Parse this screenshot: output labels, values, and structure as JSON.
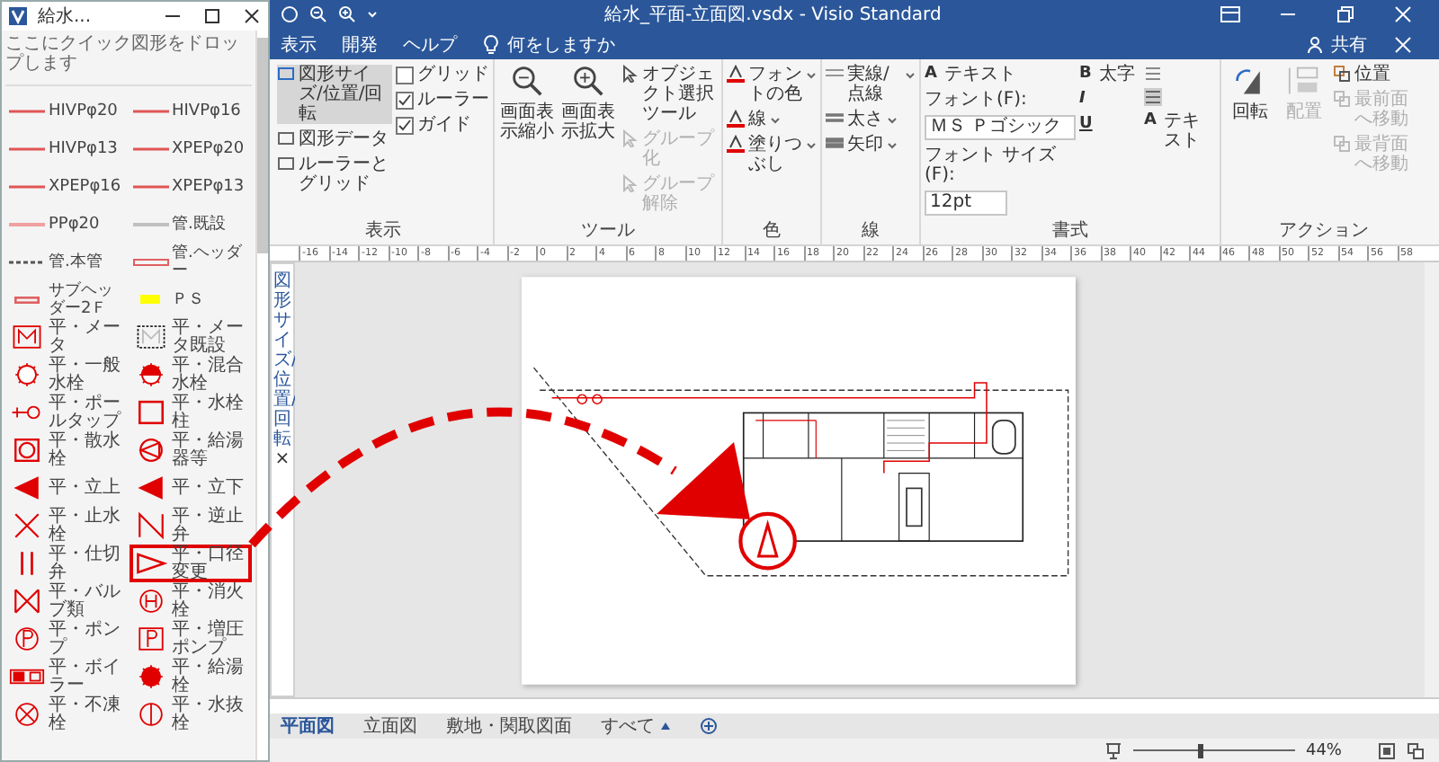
{
  "title_bar": {
    "title": "給水_平面-立面図.vsdx  -  Visio Standard"
  },
  "menu": {
    "tabs": [
      "表示",
      "開発",
      "ヘルプ"
    ],
    "tell_me": "何をしますか",
    "share": "共有"
  },
  "ribbon": {
    "view": {
      "label": "表示",
      "buttons": [
        {
          "label": "図形サイズ/位置/回転",
          "selected": true
        },
        {
          "label": "図形データ",
          "selected": false
        },
        {
          "label": "ルーラーとグリッド",
          "selected": false
        }
      ],
      "checks": [
        {
          "label": "グリッド",
          "checked": false
        },
        {
          "label": "ルーラー",
          "checked": true
        },
        {
          "label": "ガイド",
          "checked": true
        }
      ]
    },
    "tools": {
      "label": "ツール",
      "zoom": [
        {
          "label": "画面表示縮小",
          "kind": "zoom-out"
        },
        {
          "label": "画面表示拡大",
          "kind": "zoom-in"
        }
      ],
      "items": [
        {
          "label": "オブジェクト選択ツール",
          "disabled": false
        },
        {
          "label": "グループ化",
          "disabled": true
        },
        {
          "label": "グループ解除",
          "disabled": true
        }
      ]
    },
    "color": {
      "label": "色",
      "items": [
        "フォントの色",
        "線",
        "塗りつぶし"
      ]
    },
    "line": {
      "label": "線",
      "items": [
        "実線/点線",
        "太さ",
        "矢印"
      ]
    },
    "format": {
      "label": "書式",
      "text_button": {
        "glyph": "A",
        "label": "テキスト"
      },
      "font_label": "フォント(F):",
      "font": "ＭＳ Ｐゴシック",
      "size_label": "フォント サイズ(F):",
      "size": "12pt",
      "bold_glyph": "B",
      "bold": "太字",
      "italic": "I",
      "underline": "U",
      "text_button_2": {
        "glyph": "A",
        "label": "テキスト"
      }
    },
    "actions": {
      "label": "アクション",
      "rotate": "回転",
      "arrange": {
        "label": "配置",
        "disabled": true
      },
      "items": [
        {
          "label": "位置",
          "disabled": false
        },
        {
          "label": "最前面へ移動",
          "disabled": true
        },
        {
          "label": "最背面へ移動",
          "disabled": true
        }
      ]
    }
  },
  "stencil": {
    "title": "給水...",
    "hint": "ここにクイック図形をドロップします",
    "items": [
      {
        "label": "HIVPφ20",
        "kind": "line",
        "color": "#e05555",
        "selected": false
      },
      {
        "label": "HIVPφ16",
        "kind": "line",
        "color": "#e05555",
        "selected": false
      },
      {
        "label": "HIVPφ13",
        "kind": "line",
        "color": "#e05555",
        "selected": false
      },
      {
        "label": "XPEPφ20",
        "kind": "line",
        "color": "#e05555",
        "selected": false
      },
      {
        "label": "XPEPφ16",
        "kind": "line",
        "color": "#e05555",
        "selected": false
      },
      {
        "label": "XPEPφ13",
        "kind": "line",
        "color": "#e05555",
        "selected": false
      },
      {
        "label": "PPφ20",
        "kind": "thick-line",
        "color": "#f0a0a0",
        "selected": false
      },
      {
        "label": "管.既設",
        "kind": "thick-line",
        "color": "#c0c0c0",
        "selected": false
      },
      {
        "label": "管.本管",
        "kind": "dashed",
        "color": "#555555",
        "selected": false
      },
      {
        "label": "管.ヘッダー",
        "kind": "double",
        "color": "#e06060",
        "selected": false
      },
      {
        "label": "サブヘッダー2Ｆ",
        "kind": "block",
        "color": "#e06060",
        "selected": false
      },
      {
        "label": "ＰＳ",
        "kind": "fill-block",
        "color": "#ffff00",
        "selected": false
      },
      {
        "label": "平・メータ",
        "kind": "meter",
        "selected": false
      },
      {
        "label": "平・メータ既設",
        "kind": "meter-dashed",
        "selected": false
      },
      {
        "label": "平・一般水栓",
        "kind": "spiked-circle",
        "selected": false
      },
      {
        "label": "平・混合水栓",
        "kind": "half-spiked",
        "selected": false
      },
      {
        "label": "平・ポールタップ",
        "kind": "pole-tap",
        "selected": false
      },
      {
        "label": "平・水栓柱",
        "kind": "square",
        "selected": false
      },
      {
        "label": "平・散水栓",
        "kind": "boxed-circle",
        "selected": false
      },
      {
        "label": "平・給湯器等",
        "kind": "circle-triangle",
        "selected": false
      },
      {
        "label": "平・立上",
        "kind": "filled-triangle",
        "selected": false
      },
      {
        "label": "平・立下",
        "kind": "filled-triangle",
        "selected": false
      },
      {
        "label": "平・止水栓",
        "kind": "cross",
        "selected": false
      },
      {
        "label": "平・逆止弁",
        "kind": "check",
        "selected": false
      },
      {
        "label": "平・仕切弁",
        "kind": "double-bar",
        "selected": false
      },
      {
        "label": "平・口径変更",
        "kind": "open-triangle",
        "selected": true
      },
      {
        "label": "平・バルブ類",
        "kind": "bowtie",
        "selected": false
      },
      {
        "label": "平・消火栓",
        "kind": "circle-h",
        "selected": false
      },
      {
        "label": "平・ポンプ",
        "kind": "circle-p",
        "selected": false
      },
      {
        "label": "平・増圧ポンプ",
        "kind": "box-p",
        "selected": false
      },
      {
        "label": "平・ボイラー",
        "kind": "boiler",
        "selected": false
      },
      {
        "label": "平・給湯栓",
        "kind": "filled-spiked",
        "selected": false
      },
      {
        "label": "平・不凍栓",
        "kind": "circle-x",
        "selected": false
      },
      {
        "label": "平・水抜栓",
        "kind": "circle-line",
        "selected": false
      }
    ]
  },
  "side_pane": {
    "title": "図形サイズ/位置/回転",
    "close": "×"
  },
  "ruler": [
    "-16",
    "-14",
    "-12",
    "-10",
    "-8",
    "-6",
    "-4",
    "-2",
    "0",
    "2",
    "4",
    "6",
    "8",
    "10",
    "12",
    "14",
    "16",
    "18",
    "20",
    "22",
    "24",
    "26",
    "28",
    "30",
    "32",
    "34",
    "36",
    "38",
    "40",
    "42",
    "44",
    "46",
    "48",
    "50",
    "52",
    "54",
    "56",
    "58"
  ],
  "page_tabs": {
    "tabs": [
      {
        "label": "平面図",
        "selected": true
      },
      {
        "label": "立面図",
        "selected": false
      },
      {
        "label": "敷地・関取図面",
        "selected": false
      }
    ],
    "all": "すべて"
  },
  "status": {
    "zoom": "44%",
    "zoom_slider": {
      "level": 0.42
    }
  }
}
